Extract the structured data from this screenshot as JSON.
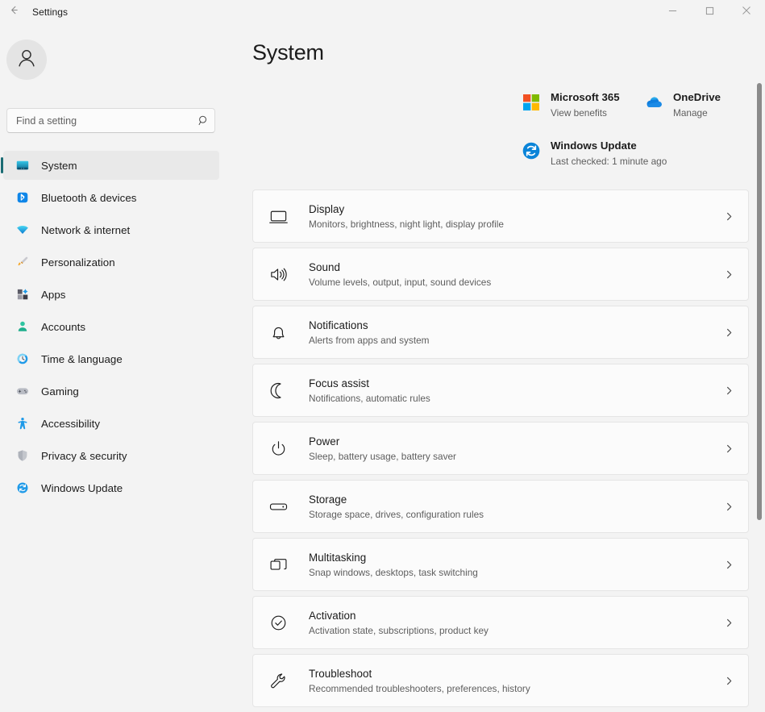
{
  "titlebar": {
    "back_icon": "back-arrow-icon",
    "title": "Settings",
    "minimize_label": "—",
    "maximize_label": "□",
    "close_label": "✕"
  },
  "sidebar": {
    "avatar_icon": "person-avatar-icon",
    "search": {
      "placeholder": "Find a setting",
      "value": "",
      "icon": "search-icon"
    },
    "items": [
      {
        "label": "System",
        "icon": "monitor-icon",
        "selected": true
      },
      {
        "label": "Bluetooth & devices",
        "icon": "bluetooth-icon",
        "selected": false
      },
      {
        "label": "Network & internet",
        "icon": "wifi-icon",
        "selected": false
      },
      {
        "label": "Personalization",
        "icon": "paintbrush-icon",
        "selected": false
      },
      {
        "label": "Apps",
        "icon": "apps-grid-icon",
        "selected": false
      },
      {
        "label": "Accounts",
        "icon": "account-person-icon",
        "selected": false
      },
      {
        "label": "Time & language",
        "icon": "clock-globe-icon",
        "selected": false
      },
      {
        "label": "Gaming",
        "icon": "gamepad-icon",
        "selected": false
      },
      {
        "label": "Accessibility",
        "icon": "accessibility-person-icon",
        "selected": false
      },
      {
        "label": "Privacy & security",
        "icon": "shield-icon",
        "selected": false
      },
      {
        "label": "Windows Update",
        "icon": "sync-refresh-icon",
        "selected": false
      }
    ]
  },
  "main": {
    "page_title": "System",
    "status_tiles": [
      {
        "title": "Microsoft 365",
        "subtitle": "View benefits",
        "icon": "microsoft-logo-icon"
      },
      {
        "title": "OneDrive",
        "subtitle": "Manage",
        "icon": "onedrive-cloud-icon"
      },
      {
        "title": "Windows Update",
        "subtitle": "Last checked: 1 minute ago",
        "icon": "sync-refresh-icon"
      }
    ],
    "cards": [
      {
        "title": "Display",
        "subtitle": "Monitors, brightness, night light, display profile",
        "icon": "monitor-outline-icon"
      },
      {
        "title": "Sound",
        "subtitle": "Volume levels, output, input, sound devices",
        "icon": "speaker-icon"
      },
      {
        "title": "Notifications",
        "subtitle": "Alerts from apps and system",
        "icon": "bell-icon"
      },
      {
        "title": "Focus assist",
        "subtitle": "Notifications, automatic rules",
        "icon": "moon-icon"
      },
      {
        "title": "Power",
        "subtitle": "Sleep, battery usage, battery saver",
        "icon": "power-icon"
      },
      {
        "title": "Storage",
        "subtitle": "Storage space, drives, configuration rules",
        "icon": "drive-icon"
      },
      {
        "title": "Multitasking",
        "subtitle": "Snap windows, desktops, task switching",
        "icon": "windows-stack-icon"
      },
      {
        "title": "Activation",
        "subtitle": "Activation state, subscriptions, product key",
        "icon": "check-circle-icon"
      },
      {
        "title": "Troubleshoot",
        "subtitle": "Recommended troubleshooters, preferences, history",
        "icon": "wrench-icon"
      }
    ],
    "chevron_icon": "chevron-right-icon"
  },
  "scrollbar": {
    "name": "vertical-scrollbar"
  },
  "colors": {
    "accent": "#1a6b73",
    "page_bg": "#f3f3f3",
    "card_bg": "#fbfbfb",
    "ms_red": "#f25022",
    "ms_green": "#7fba00",
    "ms_blue": "#00a4ef",
    "ms_yellow": "#ffb900",
    "onedrive_blue": "#0364b8",
    "update_blue": "#0a84d8"
  }
}
